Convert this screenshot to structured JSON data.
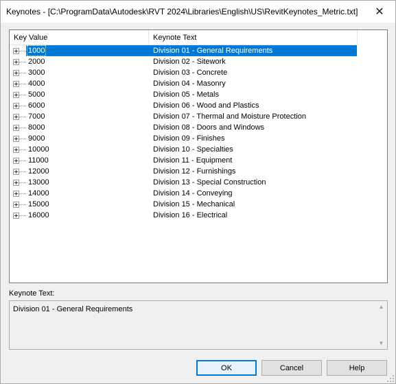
{
  "window": {
    "title": "Keynotes - [C:\\ProgramData\\Autodesk\\RVT 2024\\Libraries\\English\\US\\RevitKeynotes_Metric.txt]",
    "close_glyph": "✕"
  },
  "tree": {
    "columns": [
      "Key Value",
      "Keynote Text"
    ],
    "selected_index": 0,
    "rows": [
      {
        "key": "1000",
        "text": "Division 01 - General Requirements"
      },
      {
        "key": "2000",
        "text": "Division 02 - Sitework"
      },
      {
        "key": "3000",
        "text": "Division 03 - Concrete"
      },
      {
        "key": "4000",
        "text": "Division 04 - Masonry"
      },
      {
        "key": "5000",
        "text": "Division 05 - Metals"
      },
      {
        "key": "6000",
        "text": "Division 06 - Wood and Plastics"
      },
      {
        "key": "7000",
        "text": "Division 07 - Thermal and Moisture Protection"
      },
      {
        "key": "8000",
        "text": "Division 08 - Doors and Windows"
      },
      {
        "key": "9000",
        "text": "Division 09 - Finishes"
      },
      {
        "key": "10000",
        "text": "Division 10 - Specialties"
      },
      {
        "key": "11000",
        "text": "Division 11 - Equipment"
      },
      {
        "key": "12000",
        "text": "Division 12 - Furnishings"
      },
      {
        "key": "13000",
        "text": "Division 13 - Special Construction"
      },
      {
        "key": "14000",
        "text": "Division 14 - Conveying"
      },
      {
        "key": "15000",
        "text": "Division 15 - Mechanical"
      },
      {
        "key": "16000",
        "text": "Division 16 - Electrical"
      }
    ]
  },
  "keynote_text": {
    "label": "Keynote Text:",
    "value": "Division 01 - General Requirements"
  },
  "buttons": {
    "ok": "OK",
    "cancel": "Cancel",
    "help": "Help"
  },
  "colors": {
    "selection": "#0078d7",
    "default_button_border": "#0078d7"
  }
}
